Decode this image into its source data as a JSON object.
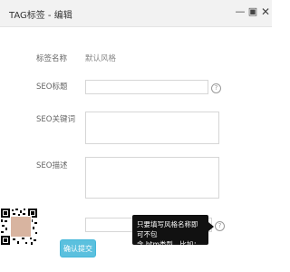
{
  "window": {
    "title": "TAG标签 - 编辑",
    "minimize_icon": "minimize-icon",
    "maximize_icon": "maximize-icon",
    "close_icon": "close-icon"
  },
  "form": {
    "tag_name_label": "标签名称",
    "tag_name_value": "默认风格",
    "seo_title_label": "SEO标题",
    "seo_title_value": "",
    "seo_keywords_label": "SEO关键词",
    "seo_keywords_value": "",
    "seo_description_label": "SEO描述",
    "seo_description_value": "",
    "static_name_value": "",
    "help_symbol": "?"
  },
  "tooltip": {
    "line1": "只要填写风格名称即可不包",
    "line2": "含.htm类型，比如：tagindex"
  },
  "actions": {
    "submit_label": "确认提交"
  },
  "colors": {
    "submit_bg": "#5bc0de",
    "tooltip_bg": "#111111"
  }
}
